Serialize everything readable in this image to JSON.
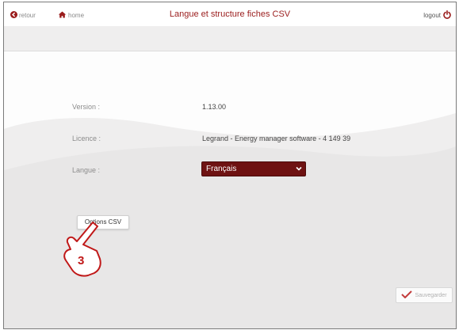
{
  "header": {
    "back_label": "retour",
    "home_label": "home",
    "title": "Langue et structure fiches CSV",
    "logout_label": "logout"
  },
  "info": {
    "version_label": "Version :",
    "version_value": "1.13.00",
    "licence_label": "Licence :",
    "licence_value": "Legrand - Energy manager software - 4 149 39",
    "langue_label": "Langue :",
    "langue_selected": "Français"
  },
  "actions": {
    "options_csv_label": "Options CSV",
    "save_label": "Sauvegarder"
  },
  "annotation": {
    "step_number": "3"
  },
  "colors": {
    "title": "#9a1c1c",
    "select_bg": "#6e1212",
    "back_icon": "#9a1c1c",
    "home_icon": "#9a1c1c",
    "logout_icon": "#9a1c1c",
    "hand_stroke": "#c01818"
  },
  "icons": {
    "back": "circle-arrow-left-icon",
    "home": "house-icon",
    "logout": "power-icon",
    "select": "chevron-down-icon",
    "save": "checkmark-icon",
    "pointer": "pointing-hand-icon"
  }
}
